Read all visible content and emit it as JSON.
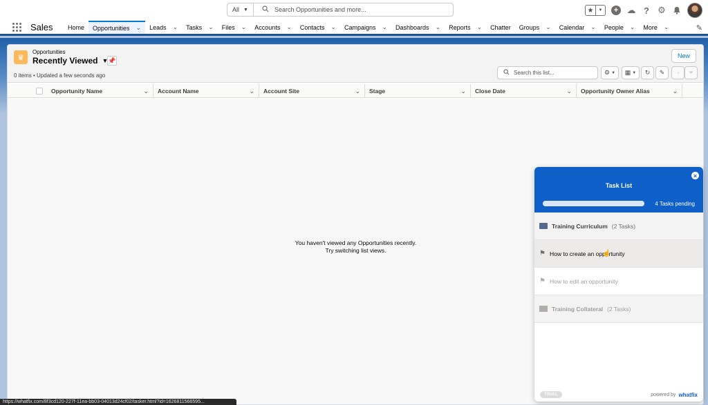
{
  "global_header": {
    "search_scope": "All",
    "search_placeholder": "Search Opportunities and more...",
    "icons": [
      "favorites-star-icon",
      "add-icon",
      "trailhead-icon",
      "help-icon",
      "setup-gear-icon",
      "notifications-bell-icon",
      "avatar"
    ]
  },
  "nav": {
    "app_name": "Sales",
    "items": [
      {
        "label": "Home",
        "chevron": false,
        "active": false
      },
      {
        "label": "Opportunities",
        "chevron": true,
        "active": true
      },
      {
        "label": "Leads",
        "chevron": true,
        "active": false
      },
      {
        "label": "Tasks",
        "chevron": true,
        "active": false
      },
      {
        "label": "Files",
        "chevron": true,
        "active": false
      },
      {
        "label": "Accounts",
        "chevron": true,
        "active": false
      },
      {
        "label": "Contacts",
        "chevron": true,
        "active": false
      },
      {
        "label": "Campaigns",
        "chevron": true,
        "active": false
      },
      {
        "label": "Dashboards",
        "chevron": true,
        "active": false
      },
      {
        "label": "Reports",
        "chevron": true,
        "active": false
      },
      {
        "label": "Chatter",
        "chevron": false,
        "active": false
      },
      {
        "label": "Groups",
        "chevron": true,
        "active": false
      },
      {
        "label": "Calendar",
        "chevron": true,
        "active": false
      },
      {
        "label": "People",
        "chevron": true,
        "active": false
      },
      {
        "label": "More",
        "chevron": true,
        "active": false
      }
    ]
  },
  "list_view": {
    "object_label": "Opportunities",
    "view_name": "Recently Viewed",
    "meta": "0 items • Updated a few seconds ago",
    "new_button": "New",
    "search_placeholder": "Search this list...",
    "columns": [
      "Opportunity Name",
      "Account Name",
      "Account Site",
      "Stage",
      "Close Date",
      "Opportunity Owner Alias"
    ],
    "empty_line1": "You haven't viewed any Opportunities recently.",
    "empty_line2": "Try switching list views."
  },
  "task_list": {
    "title": "Task List",
    "progress": 0,
    "pending": "4 Tasks pending",
    "sections": [
      {
        "title": "Training Curriculum",
        "count": "(2 Tasks)"
      },
      {
        "title": "Training Collateral",
        "count": "(2 Tasks)"
      }
    ],
    "tasks": [
      "How to create an opportunity",
      "How to edit an opportunity"
    ],
    "trial_badge": "TRIAL",
    "powered_by": "powered by",
    "brand": "whatfix"
  },
  "status_url": "https://whatfix.com/8f3cd120-227f-11ea-bb03-04013d24cf02/tasker.html?id=1626811566595..."
}
